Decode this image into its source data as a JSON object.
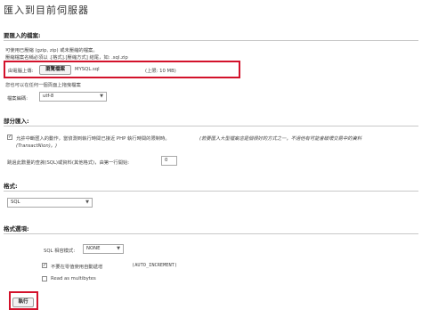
{
  "page": {
    "title": "匯入到目前伺服器"
  },
  "file_section": {
    "heading": "要匯入的檔案:",
    "compress_note": "可使用已壓縮 (gzip, zip) 或未壓縮的檔案。",
    "name_note": "壓縮檔案名稱必須以 .[格式].[壓縮方式] 結尾，如: .sql.zip",
    "upload_label": "由電腦上傳:",
    "browse_button": "瀏覽檔案",
    "file_name": "MYSQL.sql",
    "max_size": "(上限: 10 MB)",
    "drag_note": "您也可以在任何一個頁面上拖曳檔案",
    "charset_label": "檔案編碼:",
    "charset_value": "utf-8"
  },
  "partial_section": {
    "heading": "部分匯入:",
    "interrupt_text": "允許中斷匯入的動作，當偵測到執行時間已接近 PHP 執行時間的限制時。",
    "interrupt_note": "(若要匯入大型檔案這是個很好的方式之一，不過他有可能會破壞交易中的資料",
    "interrupt_note2": "(TransactNion)。)",
    "interrupt_checked": true,
    "skip_label": "跳過此數量的查詢(SQL)或資料(其他格式)，由第一行開始:",
    "skip_value": "0"
  },
  "format_section": {
    "heading": "格式:",
    "format_value": "SQL"
  },
  "format_options": {
    "heading": "格式選項:",
    "compat_label": "SQL 相容模式:",
    "compat_value": "NONE",
    "auto_inc_label": "不要在零值使用自動遞增",
    "auto_inc_code": "(AUTO_INCREMENT)",
    "auto_inc_checked": true,
    "multibyte_label": "Read as multibytes",
    "multibyte_checked": false
  },
  "actions": {
    "go_button": "執行"
  },
  "colors": {
    "highlight": "#d3122b"
  }
}
